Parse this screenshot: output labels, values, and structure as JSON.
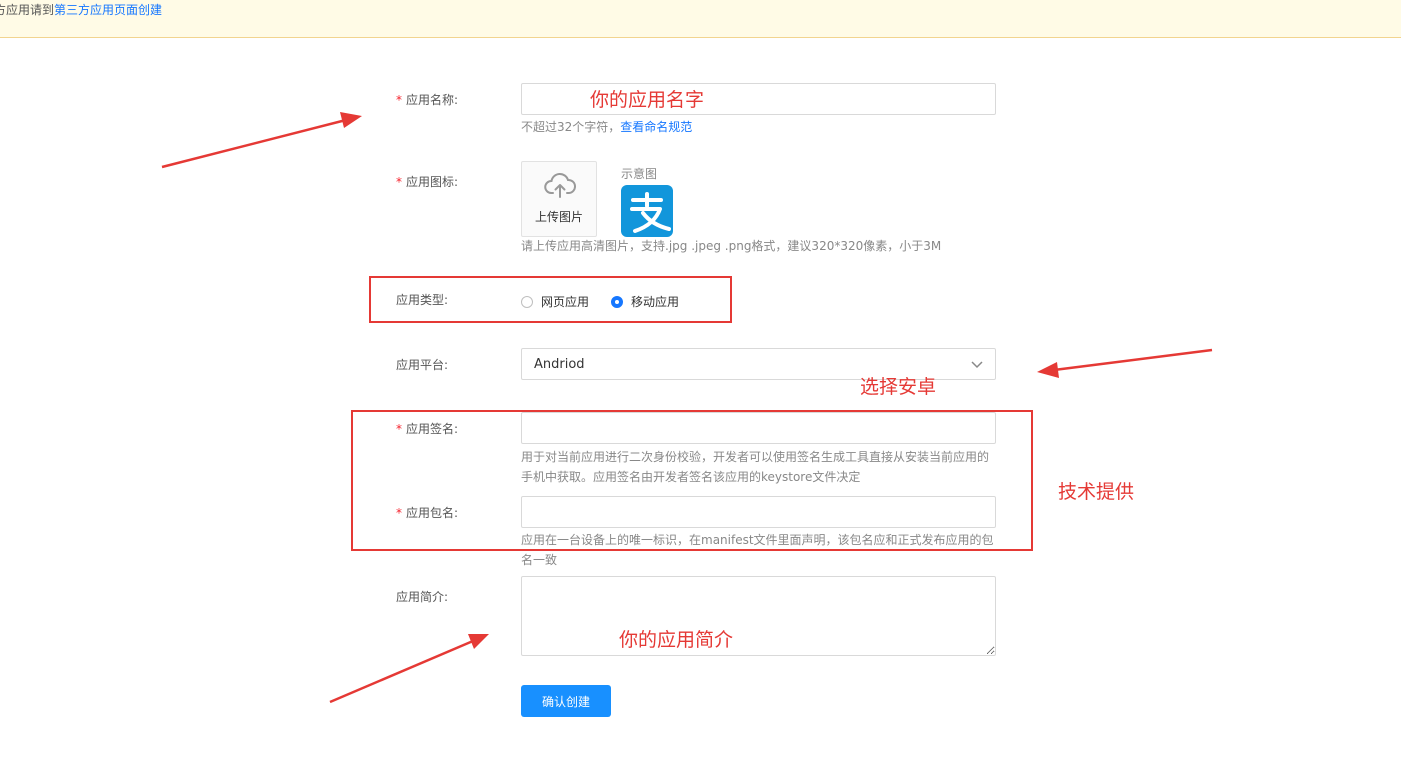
{
  "notice": {
    "prefix": "方应用请到",
    "link": "第三方应用页面创建"
  },
  "form": {
    "name": {
      "label": "应用名称:",
      "value": "",
      "help_prefix": "不超过32个字符，",
      "help_link": "查看命名规范"
    },
    "icon": {
      "label": "应用图标:",
      "upload_text": "上传图片",
      "sample_label": "示意图",
      "help": "请上传应用高清图片，支持.jpg .jpeg .png格式，建议320*320像素，小于3M"
    },
    "type": {
      "label": "应用类型:",
      "options": [
        "网页应用",
        "移动应用"
      ],
      "selected": "移动应用"
    },
    "platform": {
      "label": "应用平台:",
      "value": "Andriod"
    },
    "signature": {
      "label": "应用签名:",
      "value": "",
      "help_line1": "用于对当前应用进行二次身份校验，开发者可以使用签名生成工具直接从安装当前应用的",
      "help_line2": "手机中获取。应用签名由开发者签名该应用的keystore文件决定"
    },
    "package": {
      "label": "应用包名:",
      "value": "",
      "help_line1": "应用在一台设备上的唯一标识，在manifest文件里面声明，该包名应和正式发布应用的包",
      "help_line2": "名一致"
    },
    "description": {
      "label": "应用简介:",
      "value": ""
    },
    "submit_label": "确认创建"
  },
  "annotations": {
    "name_hint": "你的应用名字",
    "platform_hint": "选择安卓",
    "tech_hint": "技术提供",
    "desc_hint": "你的应用简介"
  },
  "colors": {
    "primary": "#1890ff",
    "annotation": "#e53935",
    "required": "#f5222d",
    "notice_bg": "#fffbe6",
    "alipay_blue": "#1296db"
  }
}
